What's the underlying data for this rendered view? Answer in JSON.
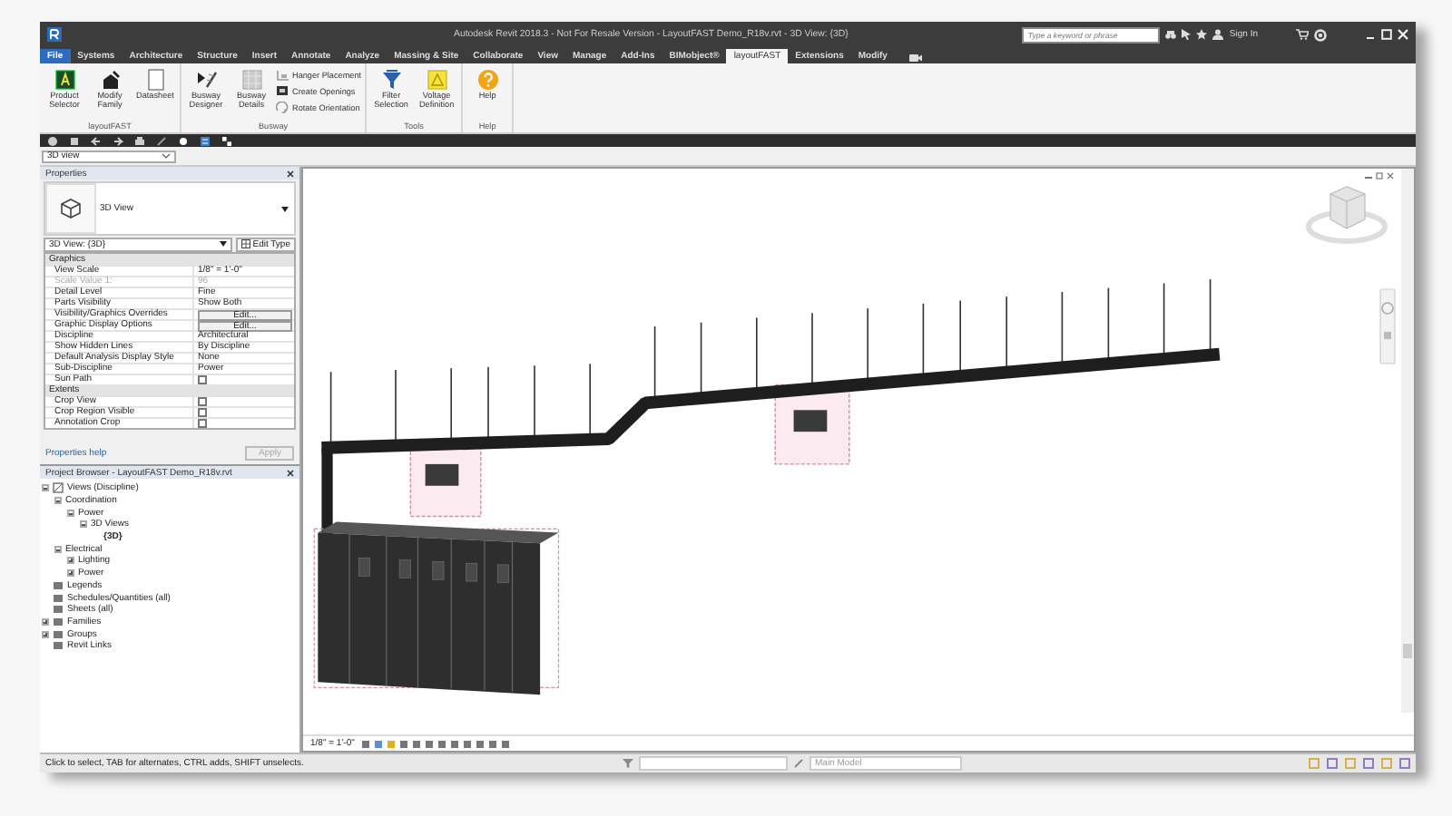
{
  "window": {
    "title": "Autodesk Revit 2018.3 - Not For Resale Version -  LayoutFAST Demo_R18v.rvt - 3D View: {3D}"
  },
  "search": {
    "placeholder": "Type a keyword or phrase"
  },
  "account": {
    "label": "Sign In"
  },
  "ribbon_tabs": [
    {
      "label": "File",
      "kind": "file",
      "selected": false
    },
    {
      "label": "Systems",
      "kind": "tab",
      "selected": false
    },
    {
      "label": "Architecture",
      "kind": "tab",
      "selected": false
    },
    {
      "label": "Structure",
      "kind": "tab",
      "selected": false
    },
    {
      "label": "Insert",
      "kind": "tab",
      "selected": false
    },
    {
      "label": "Annotate",
      "kind": "tab",
      "selected": false
    },
    {
      "label": "Analyze",
      "kind": "tab",
      "selected": false
    },
    {
      "label": "Massing & Site",
      "kind": "tab",
      "selected": false
    },
    {
      "label": "Collaborate",
      "kind": "tab",
      "selected": false
    },
    {
      "label": "View",
      "kind": "tab",
      "selected": false
    },
    {
      "label": "Manage",
      "kind": "tab",
      "selected": false
    },
    {
      "label": "Add-Ins",
      "kind": "tab",
      "selected": false
    },
    {
      "label": "BIMobject®",
      "kind": "tab",
      "selected": false
    },
    {
      "label": "layoutFAST",
      "kind": "tab",
      "selected": true
    },
    {
      "label": "Extensions",
      "kind": "tab",
      "selected": false
    },
    {
      "label": "Modify",
      "kind": "tab",
      "selected": false
    }
  ],
  "ribbon_panels": [
    {
      "title": "layoutFAST",
      "buttons": [
        {
          "label": "Product Selector",
          "kind": "large"
        },
        {
          "label": "Modify Family",
          "kind": "large"
        },
        {
          "label": "Datasheet",
          "kind": "large"
        }
      ]
    },
    {
      "title": "Busway",
      "buttons": [
        {
          "label": "Busway Designer",
          "kind": "large"
        },
        {
          "label": "Busway Details",
          "kind": "large"
        },
        {
          "label": "Hanger Placement",
          "kind": "small"
        },
        {
          "label": "Create Openings",
          "kind": "small"
        },
        {
          "label": "Rotate Orientation",
          "kind": "small"
        }
      ]
    },
    {
      "title": "Tools",
      "buttons": [
        {
          "label": "Filter Selection",
          "kind": "large"
        },
        {
          "label": "Voltage Definition",
          "kind": "large"
        }
      ]
    },
    {
      "title": "Help",
      "buttons": [
        {
          "label": "Help",
          "kind": "large"
        }
      ]
    }
  ],
  "view_selector": {
    "value": "3D view"
  },
  "properties": {
    "title": "Properties",
    "type_name": "3D View",
    "instance_selector": "3D View: {3D}",
    "edit_type": "Edit Type",
    "rows": [
      {
        "kind": "group",
        "label": "Graphics"
      },
      {
        "kind": "text",
        "name": "View Scale",
        "value": "1/8\" = 1'-0\"",
        "disabled": false
      },
      {
        "kind": "text",
        "name": "Scale Value    1:",
        "value": "96",
        "disabled": true
      },
      {
        "kind": "text",
        "name": "Detail Level",
        "value": "Fine",
        "disabled": false
      },
      {
        "kind": "text",
        "name": "Parts Visibility",
        "value": "Show Both",
        "disabled": false
      },
      {
        "kind": "button",
        "name": "Visibility/Graphics Overrides",
        "value": "Edit...",
        "disabled": false
      },
      {
        "kind": "button",
        "name": "Graphic Display Options",
        "value": "Edit...",
        "disabled": false
      },
      {
        "kind": "text",
        "name": "Discipline",
        "value": "Architectural",
        "disabled": false
      },
      {
        "kind": "text",
        "name": "Show Hidden Lines",
        "value": "By Discipline",
        "disabled": false
      },
      {
        "kind": "text",
        "name": "Default Analysis Display Style",
        "value": "None",
        "disabled": false
      },
      {
        "kind": "text",
        "name": "Sub-Discipline",
        "value": "Power",
        "disabled": false
      },
      {
        "kind": "checkbox",
        "name": "Sun Path",
        "checked": false,
        "disabled": false
      },
      {
        "kind": "group",
        "label": "Extents"
      },
      {
        "kind": "checkbox",
        "name": "Crop View",
        "checked": false,
        "disabled": false
      },
      {
        "kind": "checkbox",
        "name": "Crop Region Visible",
        "checked": false,
        "disabled": false
      },
      {
        "kind": "checkbox",
        "name": "Annotation Crop",
        "checked": false,
        "disabled": false
      }
    ],
    "help_link": "Properties help",
    "apply": {
      "label": "Apply",
      "disabled": true
    }
  },
  "project_browser": {
    "title": "Project Browser - LayoutFAST Demo_R18v.rvt",
    "tree": [
      {
        "label": "Views (Discipline)",
        "expanded": true,
        "children": [
          {
            "label": "Coordination",
            "expanded": true,
            "children": [
              {
                "label": "Power",
                "expanded": true,
                "children": [
                  {
                    "label": "3D Views",
                    "expanded": true,
                    "children": [
                      {
                        "label": "{3D}",
                        "selected": true
                      }
                    ]
                  }
                ]
              }
            ]
          },
          {
            "label": "Electrical",
            "expanded": true,
            "children": [
              {
                "label": "Lighting",
                "expanded": false
              },
              {
                "label": "Power",
                "expanded": false
              }
            ]
          }
        ]
      },
      {
        "label": "Legends"
      },
      {
        "label": "Schedules/Quantities (all)"
      },
      {
        "label": "Sheets (all)"
      },
      {
        "label": "Families",
        "expanded": false
      },
      {
        "label": "Groups",
        "expanded": false
      },
      {
        "label": "Revit Links"
      }
    ]
  },
  "view_control_bar": {
    "scale": "1/8\" = 1'-0\""
  },
  "status_bar": {
    "message": "Click to select, TAB for alternates, CTRL adds, SHIFT unselects.",
    "model": "Main Model"
  }
}
